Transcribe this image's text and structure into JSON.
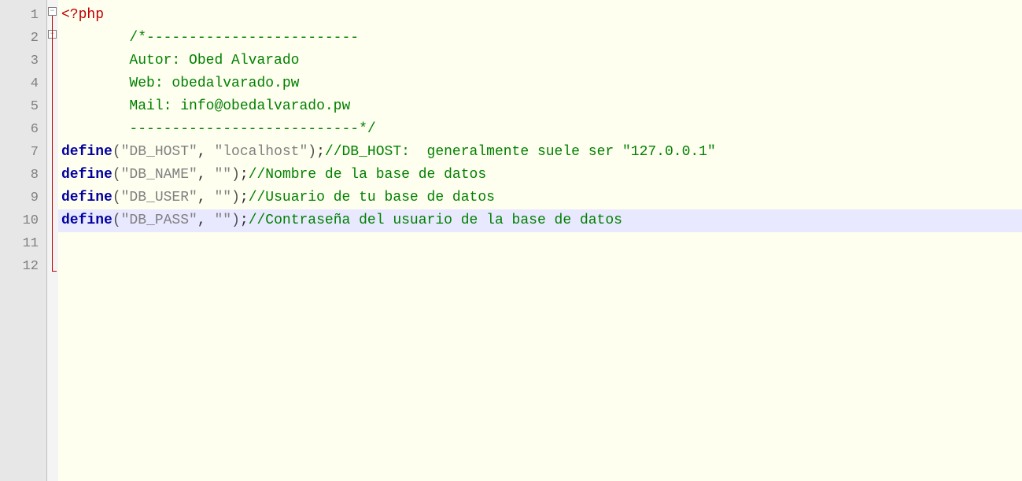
{
  "lineNumbers": [
    "1",
    "2",
    "3",
    "4",
    "5",
    "6",
    "7",
    "8",
    "9",
    "10",
    "11",
    "12"
  ],
  "code": {
    "l1": {
      "tag": "<?php"
    },
    "l2": {
      "comment": "    /*-------------------------"
    },
    "l3": {
      "comment": "    Autor: Obed Alvarado"
    },
    "l4": {
      "comment": "    Web: obedalvarado.pw"
    },
    "l5": {
      "comment": "    Mail: info@obedalvarado.pw"
    },
    "l6": {
      "comment": "    ---------------------------*/"
    },
    "l7": {
      "kw": "define",
      "op": "(",
      "s1": "\"DB_HOST\"",
      "comma": ", ",
      "s2": "\"localhost\"",
      "cp": ")",
      "semi": ";",
      "cm": "//DB_HOST:  generalmente suele ser \"127.0.0.1\""
    },
    "l8": {
      "kw": "define",
      "op": "(",
      "s1": "\"DB_NAME\"",
      "comma": ", ",
      "s2": "\"\"",
      "cp": ")",
      "semi": ";",
      "cm": "//Nombre de la base de datos"
    },
    "l9": {
      "kw": "define",
      "op": "(",
      "s1": "\"DB_USER\"",
      "comma": ", ",
      "s2": "\"\"",
      "cp": ")",
      "semi": ";",
      "cm": "//Usuario de tu base de datos"
    },
    "l10": {
      "kw": "define",
      "op": "(",
      "s1": "\"DB_PASS\"",
      "comma": ", ",
      "s2": "\"\"",
      "cp": ")",
      "semi": ";",
      "cm": "//Contraseña del usuario de la base de datos"
    }
  },
  "colors": {
    "tag": "#c00000",
    "comment": "#008000",
    "keyword": "#0000a0",
    "string": "#808080",
    "gutterBg": "#e7e7e7",
    "codeBg": "#fffff0",
    "highlight": "#e8e8ff"
  }
}
